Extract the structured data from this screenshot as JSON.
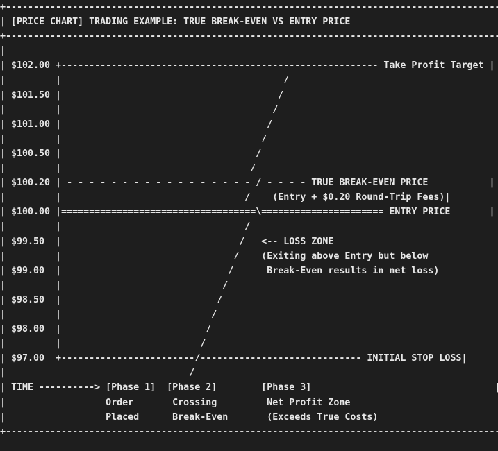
{
  "diagram": {
    "title": "[PRICE CHART] TRADING EXAMPLE: TRUE BREAK-EVEN VS ENTRY PRICE",
    "lines": [
      "+-----------------------------------------------------------------------------------------+",
      "| [PRICE CHART] TRADING EXAMPLE: TRUE BREAK-EVEN VS ENTRY PRICE                             |",
      "+-----------------------------------------------------------------------------------------+",
      "|                                                                                         |",
      "| $102.00 +--------------------------------------------------------- Take Profit Target |",
      "|         |                                        /                                      |",
      "| $101.50 |                                       /                                       |",
      "|         |                                      /                                        |",
      "| $101.00 |                                     /                                         |",
      "|         |                                    /                                          |",
      "| $100.50 |                                   /                                           |",
      "|         |                                  /                                            |",
      "| $100.20 | - - - - - - - - - - - - - - - - - / - - - - TRUE BREAK-EVEN PRICE           |",
      "|         |                                 /    (Entry + $0.20 Round-Trip Fees)|         |",
      "| $100.00 |===================================\\====================== ENTRY PRICE       |",
      "|         |                                 /                                             |",
      "| $99.50  |                                /   <-- LOSS ZONE                              |",
      "|         |                               /    (Exiting above Entry but below             |",
      "| $99.00  |                              /      Break-Even results in net loss)           |",
      "|         |                             /                                                 |",
      "| $98.50  |                            /                                                  |",
      "|         |                           /                                                   |",
      "| $98.00  |                          /                                                    |",
      "|         |                         /                                                     |",
      "| $97.00  +------------------------/----------------------------- INITIAL STOP LOSS|      |",
      "|                                 /                                                       |",
      "| TIME ----------> [Phase 1]  [Phase 2]        [Phase 3]                                 |",
      "|                  Order       Crossing         Net Profit Zone                           |",
      "|                  Placed      Break-Even       (Exceeds True Costs)                      |",
      "+-----------------------------------------------------------------------------------------+"
    ],
    "labels": {
      "take_profit": "Take Profit Target",
      "true_break_even": "TRUE BREAK-EVEN PRICE",
      "fees_note": "(Entry + $0.20 Round-Trip Fees)",
      "entry_price": "ENTRY PRICE",
      "loss_zone": "<-- LOSS ZONE",
      "loss_note_1": "(Exiting above Entry but below",
      "loss_note_2": "Break-Even results in net loss)",
      "stop_loss": "INITIAL STOP LOSS",
      "time": "TIME ---------->",
      "phase_1": [
        "[Phase 1]",
        "Order",
        "Placed"
      ],
      "phase_2": [
        "[Phase 2]",
        "Crossing",
        "Break-Even"
      ],
      "phase_3": [
        "[Phase 3]",
        "Net Profit Zone",
        "(Exceeds True Costs)"
      ]
    },
    "price_levels": [
      "$102.00",
      "$101.50",
      "$101.00",
      "$100.50",
      "$100.20",
      "$100.00",
      "$99.50",
      "$99.00",
      "$98.50",
      "$98.00",
      "$97.00"
    ]
  }
}
